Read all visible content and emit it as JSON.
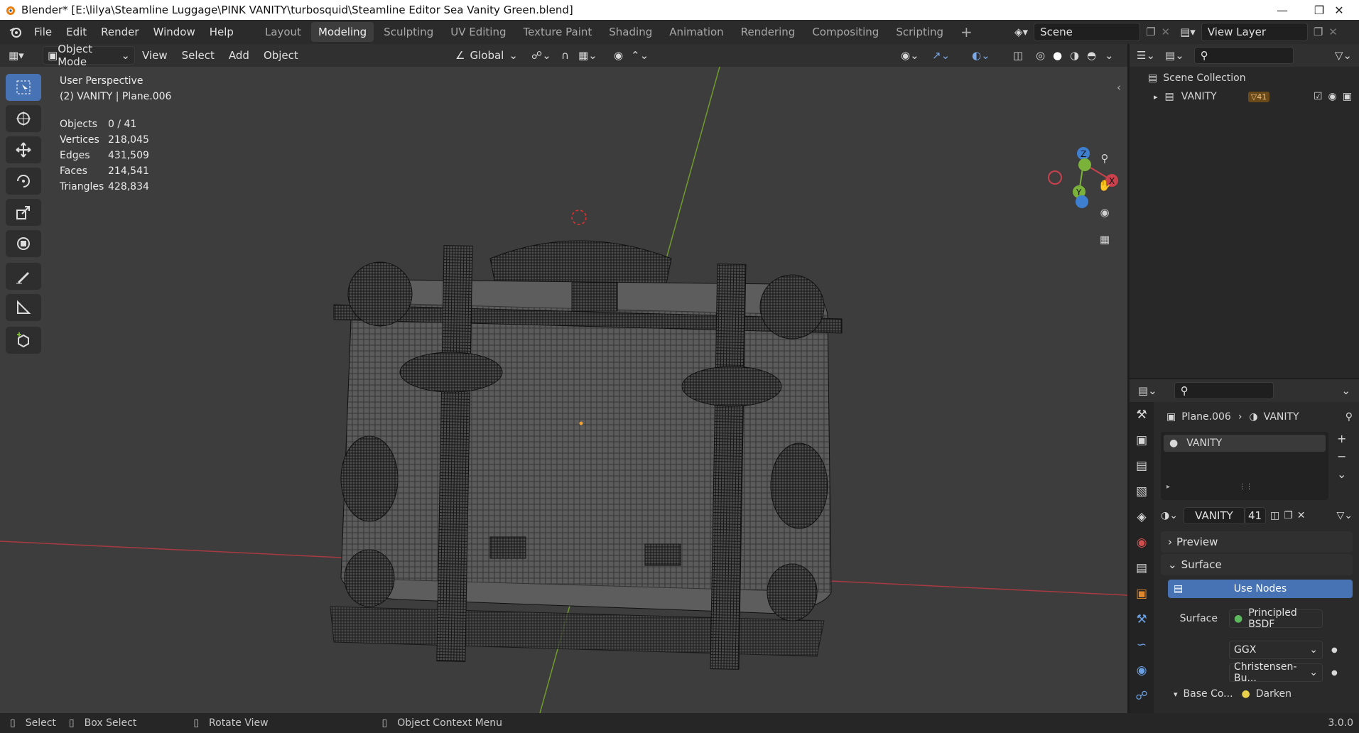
{
  "window": {
    "title": "Blender* [E:\\lilya\\Steamline Luggage\\PINK VANITY\\turbosquid\\Steamline Editor Sea Vanity Green.blend]"
  },
  "menu": [
    "File",
    "Edit",
    "Render",
    "Window",
    "Help"
  ],
  "workspaces": [
    "Layout",
    "Modeling",
    "Sculpting",
    "UV Editing",
    "Texture Paint",
    "Shading",
    "Animation",
    "Rendering",
    "Compositing",
    "Scripting"
  ],
  "active_workspace": "Modeling",
  "scene": {
    "name": "Scene",
    "view_layer": "View Layer"
  },
  "header": {
    "mode": "Object Mode",
    "menus": [
      "View",
      "Select",
      "Add",
      "Object"
    ],
    "orientation": "Global"
  },
  "viewport": {
    "perspective": "User Perspective",
    "context": "(2)  VANITY | Plane.006",
    "stats": [
      {
        "label": "Objects",
        "value": "0 / 41"
      },
      {
        "label": "Vertices",
        "value": "218,045"
      },
      {
        "label": "Edges",
        "value": "431,509"
      },
      {
        "label": "Faces",
        "value": "214,541"
      },
      {
        "label": "Triangles",
        "value": "428,834"
      }
    ],
    "gizmo": {
      "z": "Z",
      "y": "Y",
      "x": "X"
    }
  },
  "outliner": {
    "root": "Scene Collection",
    "collection": "VANITY",
    "count": "41"
  },
  "properties": {
    "breadcrumb_object": "Plane.006",
    "breadcrumb_material": "VANITY",
    "material_slot": "VANITY",
    "material_name": "VANITY",
    "users": "41",
    "preview_label": "Preview",
    "surface_label": "Surface",
    "use_nodes": "Use Nodes",
    "surface_field_label": "Surface",
    "surface_shader": "Principled BSDF",
    "distribution": "GGX",
    "subsurface": "Christensen-Bu...",
    "base_color_label": "Base Co...",
    "base_color_value": "Darken"
  },
  "status": {
    "select": "Select",
    "box_select": "Box Select",
    "rotate": "Rotate View",
    "context_menu": "Object Context Menu",
    "version": "3.0.0"
  },
  "colors": {
    "accent": "#4772b3",
    "x_axis": "#c8414c",
    "y_axis": "#7bb33a",
    "z_axis": "#3f7fd0"
  }
}
